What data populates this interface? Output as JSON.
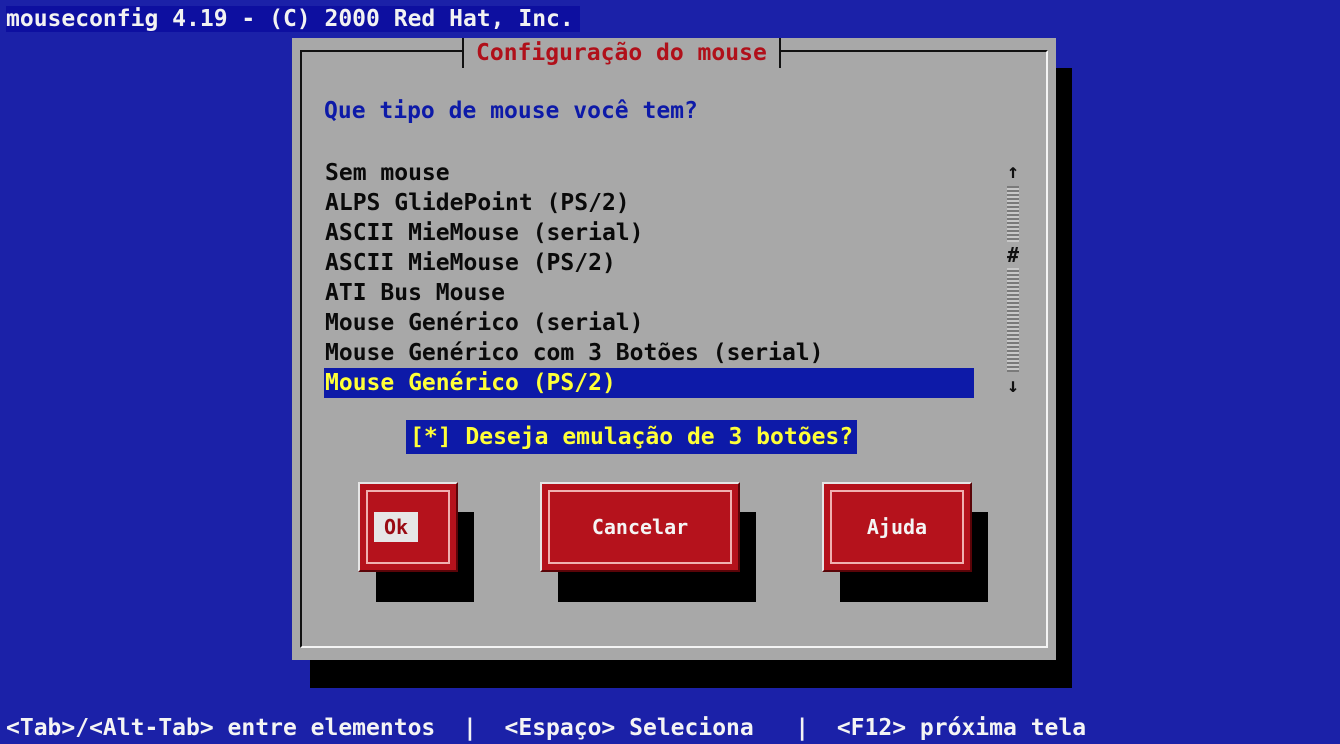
{
  "window": {
    "top_title": "mouseconfig 4.19 - (C) 2000 Red Hat, Inc.",
    "dialog_title": "Configuração do mouse"
  },
  "dialog": {
    "question": "Que tipo de mouse você tem?",
    "mouse_list": [
      "Sem mouse",
      "ALPS GlidePoint (PS/2)",
      "ASCII MieMouse (serial)",
      "ASCII MieMouse (PS/2)",
      "ATI Bus Mouse",
      "Mouse Genérico (serial)",
      "Mouse Genérico com 3 Botões (serial)",
      "Mouse Genérico (PS/2)"
    ],
    "selected_index": 7,
    "scrollbar": {
      "up": "↑",
      "down": "↓",
      "thumb": "#"
    },
    "emulation_checkbox": "[*] Deseja emulação de 3 botões?",
    "buttons": {
      "ok": "Ok",
      "cancel": "Cancelar",
      "help": "Ajuda"
    }
  },
  "status_bar": "<Tab>/<Alt-Tab> entre elementos  |  <Espaço> Seleciona   |  <F12> próxima tela",
  "colors": {
    "background": "#1b21a8",
    "dialog": "#a8a8a8",
    "accent_red": "#b5121c",
    "selection": "#0d1aa8",
    "selection_text": "#ffff38"
  }
}
